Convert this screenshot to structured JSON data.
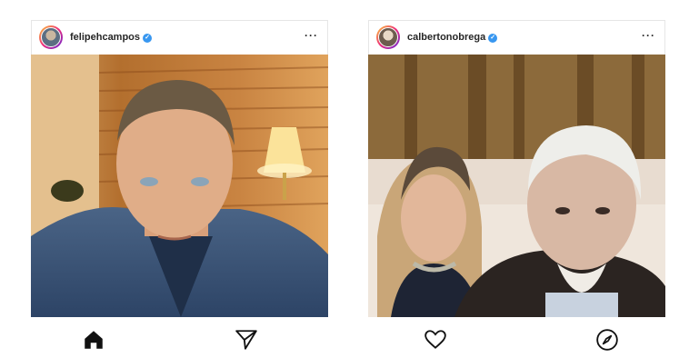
{
  "posts": [
    {
      "username": "felipehcampos",
      "verified": true,
      "more_label": "···"
    },
    {
      "username": "calbertonobrega",
      "verified": true,
      "more_label": "···"
    }
  ],
  "bottom_nav": {
    "icons": [
      "home-icon",
      "send-icon",
      "heart-icon",
      "compass-icon"
    ]
  },
  "colors": {
    "verified": "#3897f0",
    "text": "#262626"
  }
}
